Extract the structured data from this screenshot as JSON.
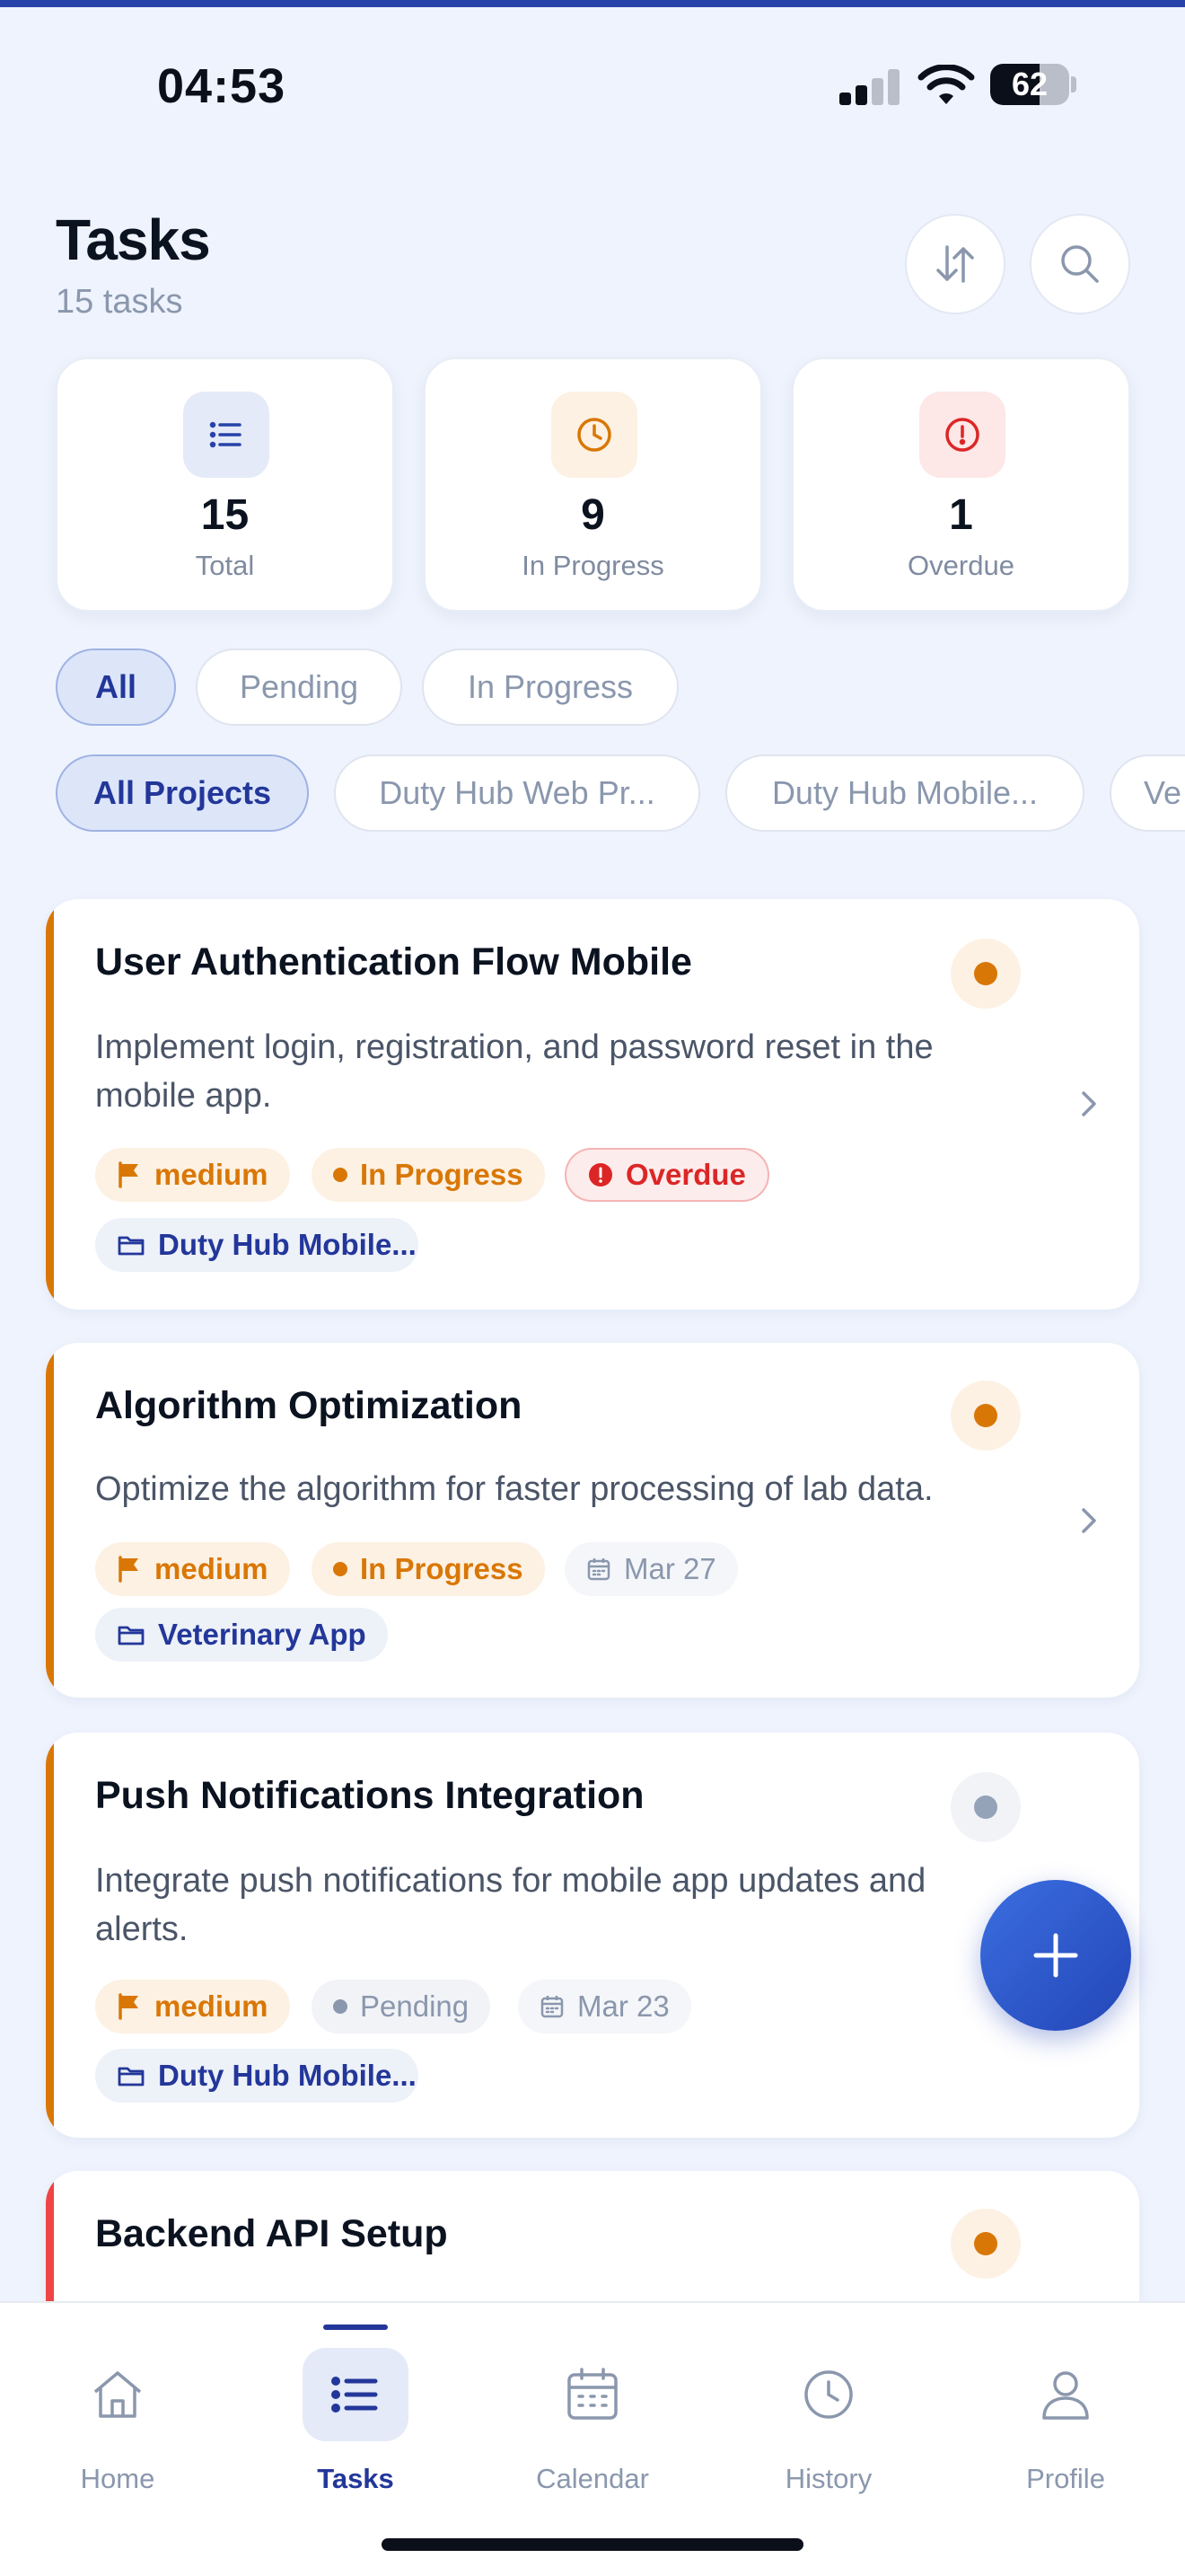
{
  "status_bar": {
    "time": "04:53",
    "battery": "62",
    "battery_level": 0.62
  },
  "header": {
    "title": "Tasks",
    "subtitle": "15 tasks"
  },
  "stats": [
    {
      "value": "15",
      "label": "Total",
      "icon": "list-icon",
      "color": "#2742a8"
    },
    {
      "value": "9",
      "label": "In Progress",
      "icon": "clock-icon",
      "color": "#d97706"
    },
    {
      "value": "1",
      "label": "Overdue",
      "icon": "alert-circle-icon",
      "color": "#dc2626"
    }
  ],
  "status_filters": [
    {
      "label": "All",
      "active": true
    },
    {
      "label": "Pending",
      "active": false
    },
    {
      "label": "In Progress",
      "active": false
    }
  ],
  "project_filters": [
    {
      "label": "All Projects",
      "active": true
    },
    {
      "label": "Duty Hub Web Pr...",
      "active": false
    },
    {
      "label": "Duty Hub Mobile...",
      "active": false
    },
    {
      "label": "Ve",
      "active": false
    }
  ],
  "tasks": [
    {
      "title": "User Authentication Flow Mobile",
      "description_lines": [
        "Implement login, registration, and password reset in the",
        "mobile app."
      ],
      "priority": "medium",
      "status": "In Progress",
      "overdue": "Overdue",
      "project": "Duty Hub Mobile...",
      "accent": "#d97706"
    },
    {
      "title": "Algorithm Optimization",
      "description_lines": [
        "Optimize the algorithm for faster processing of lab data."
      ],
      "priority": "medium",
      "status": "In Progress",
      "date": "Mar 27",
      "project": "Veterinary App",
      "accent": "#d97706"
    },
    {
      "title": "Push Notifications Integration",
      "description_lines": [
        "Integrate push notifications for mobile app updates and",
        "alerts."
      ],
      "priority": "medium",
      "status": "Pending",
      "date": "Mar 23",
      "project": "Duty Hub Mobile...",
      "accent": "#d97706"
    },
    {
      "title": "Backend API Setup",
      "accent": "#ef4444"
    }
  ],
  "nav": [
    {
      "label": "Home",
      "icon": "home-icon",
      "active": false
    },
    {
      "label": "Tasks",
      "icon": "list-icon",
      "active": true
    },
    {
      "label": "Calendar",
      "icon": "calendar-icon",
      "active": false
    },
    {
      "label": "History",
      "icon": "clock-icon",
      "active": false
    },
    {
      "label": "Profile",
      "icon": "user-icon",
      "active": false
    }
  ],
  "colors": {
    "primary": "#23379a",
    "accent_orange": "#d97706",
    "danger": "#dc2626",
    "background": "#eef3fd"
  }
}
